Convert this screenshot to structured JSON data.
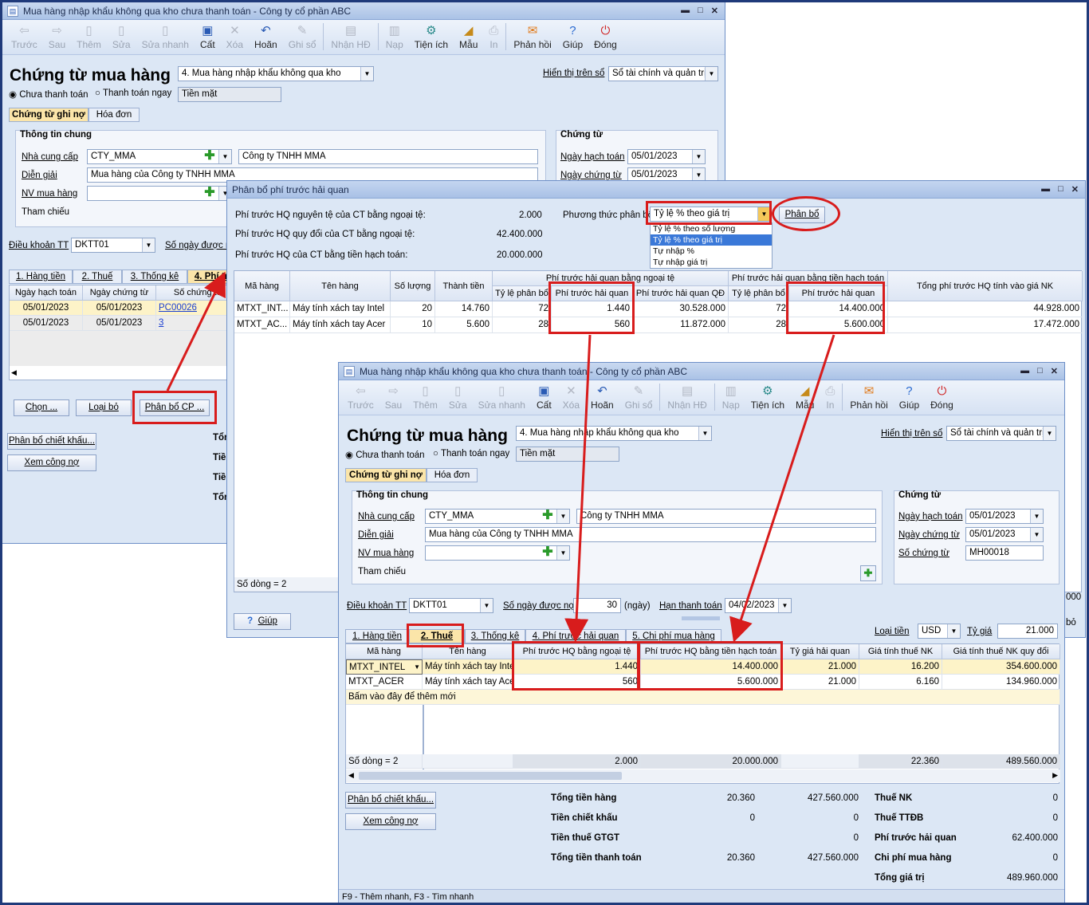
{
  "w1": {
    "title": "Mua hàng nhập khẩu không qua kho chưa thanh toán - Công ty cổ phần ABC",
    "toolbar": [
      "Trước",
      "Sau",
      "Thêm",
      "Sửa",
      "Sửa nhanh",
      "Cất",
      "Xóa",
      "Hoãn",
      "Ghi sổ",
      "Nhận HĐ",
      "Nạp",
      "Tiện ích",
      "Mẫu",
      "In",
      "Phản hồi",
      "Giúp",
      "Đóng"
    ],
    "heading": "Chứng từ mua hàng",
    "type": "4. Mua hàng nhập khẩu không qua kho",
    "show_label": "Hiển thị trên sổ",
    "show_value": "Sổ tài chính và quản trị",
    "radio1": "Chưa thanh toán",
    "radio2": "Thanh toán ngay",
    "cash": "Tiền mặt",
    "tab_voucher": "Chứng từ ghi nợ",
    "tab_invoice": "Hóa đơn",
    "general_info": "Thông tin chung",
    "supplier_label": "Nhà cung cấp",
    "supplier_code": "CTY_MMA",
    "supplier_name": "Công ty TNHH MMA",
    "desc_label": "Diễn giải",
    "desc": "Mua hàng của Công ty TNHH MMA",
    "staff_label": "NV mua hàng",
    "ref_label": "Tham chiếu",
    "voucher_group": "Chứng từ",
    "post_date_label": "Ngày hạch toán",
    "post_date": "05/01/2023",
    "voucher_date_label": "Ngày chứng từ",
    "voucher_date": "05/01/2023",
    "terms_label": "Điều khoản TT",
    "terms": "DKTT01",
    "days_label": "Số ngày được nợ",
    "tabs": [
      "1. Hàng tiền",
      "2. Thuế",
      "3. Thống kê",
      "4. Phí tr"
    ],
    "ref_headers": [
      "Ngày hạch toán",
      "Ngày chứng từ",
      "Số chứng từ"
    ],
    "ref_rows": [
      [
        "05/01/2023",
        "05/01/2023",
        "PC00026"
      ],
      [
        "05/01/2023",
        "05/01/2023",
        "3"
      ]
    ],
    "btn_choose": "Chọn ...",
    "btn_remove": "Loại bỏ",
    "btn_alloc": "Phân bổ CP ...",
    "btn_discount": "Phân bổ chiết khấu...",
    "btn_debt": "Xem công nợ",
    "tot": [
      "Tổn",
      "Tiề",
      "Tiề",
      "Tổn"
    ]
  },
  "w2": {
    "title": "Phân bổ phí trước hải quan",
    "l1": "Phí trước HQ nguyên tệ của CT bằng ngoại tệ:",
    "v1": "2.000",
    "l2": "Phí trước HQ quy đổi của CT bằng ngoại tệ:",
    "v2": "42.400.000",
    "l3": "Phí trước HQ của CT bằng tiền hạch toán:",
    "v3": "20.000.000",
    "method_label": "Phương thức phân bổ",
    "method": "Tỷ lệ % theo giá trị",
    "btn_alloc": "Phân bổ",
    "options": [
      "Tỷ lệ % theo số lượng",
      "Tỷ lệ % theo giá trị",
      "Tự nhập %",
      "Tự nhập giá trị"
    ],
    "grp_fc": "Phí trước hải quan bằng ngoại tệ",
    "grp_acc": "Phí trước hải quan bằng tiền hạch toán",
    "headers": [
      "Mã hàng",
      "Tên hàng",
      "Số lượng",
      "Thành tiền",
      "Tỷ lệ phân bổ",
      "Phí trước hải quan",
      "Phí trước hải quan QĐ",
      "Tỷ lệ phân bổ",
      "Phí trước hải quan",
      "Tổng phí trước HQ tính vào giá NK"
    ],
    "rows": [
      [
        "MTXT_INT...",
        "Máy tính xách tay Intel",
        "20",
        "14.760",
        "72",
        "1.440",
        "30.528.000",
        "72",
        "14.400.000",
        "44.928.000"
      ],
      [
        "MTXT_AC...",
        "Máy tính xách tay Acer",
        "10",
        "5.600",
        "28",
        "560",
        "11.872.000",
        "28",
        "5.600.000",
        "17.472.000"
      ]
    ],
    "row_count": "Số dòng = 2",
    "help": "Giúp",
    "edge_val": "000",
    "edge_bo": "bỏ"
  },
  "w3": {
    "title": "Mua hàng nhập khẩu không qua kho chưa thanh toán - Công ty cổ phần ABC",
    "heading": "Chứng từ mua hàng",
    "voucher_no_label": "Số chứng từ",
    "voucher_no": "MH00018",
    "days": "30",
    "days_unit": "(ngày)",
    "due_label": "Hạn thanh toán",
    "due": "04/02/2023",
    "tabs": [
      "1. Hàng tiền",
      "2. Thuế",
      "3. Thống kê",
      "4. Phí trước hải quan",
      "5. Chi phí mua hàng"
    ],
    "currency_label": "Loại tiền",
    "currency": "USD",
    "rate_label": "Tỷ giá",
    "rate": "21.000",
    "headers": [
      "Mã hàng",
      "Tên hàng",
      "Phí trước HQ bằng ngoại tệ",
      "Phí trước HQ bằng tiền hạch toán",
      "Tỷ giá hải quan",
      "Giá tính thuế NK",
      "Giá tính thuế NK quy đổi"
    ],
    "rows": [
      [
        "MTXT_INTEL",
        "Máy tính xách tay Intel",
        "1.440",
        "14.400.000",
        "21.000",
        "16.200",
        "354.600.000"
      ],
      [
        "MTXT_ACER",
        "Máy tính xách tay Acer",
        "560",
        "5.600.000",
        "21.000",
        "6.160",
        "134.960.000"
      ]
    ],
    "add_row": "Bấm vào đây để thêm mới",
    "footer": [
      "Số dòng = 2",
      "2.000",
      "20.000.000",
      "22.360",
      "489.560.000"
    ],
    "sum_labels": [
      "Tổng tiền hàng",
      "Tiền chiết khấu",
      "Tiền thuế GTGT",
      "Tổng tiền thanh toán"
    ],
    "sum_a": [
      "20.360",
      "0",
      "",
      "20.360"
    ],
    "sum_b": [
      "427.560.000",
      "0",
      "0",
      "427.560.000"
    ],
    "right_labels": [
      "Thuế NK",
      "Thuế TTĐB",
      "Phí trước hải quan",
      "Chi phí mua hàng",
      "Tổng giá trị"
    ],
    "right_values": [
      "0",
      "0",
      "62.400.000",
      "0",
      "489.960.000"
    ],
    "status": "F9 - Thêm nhanh, F3 - Tìm nhanh"
  }
}
